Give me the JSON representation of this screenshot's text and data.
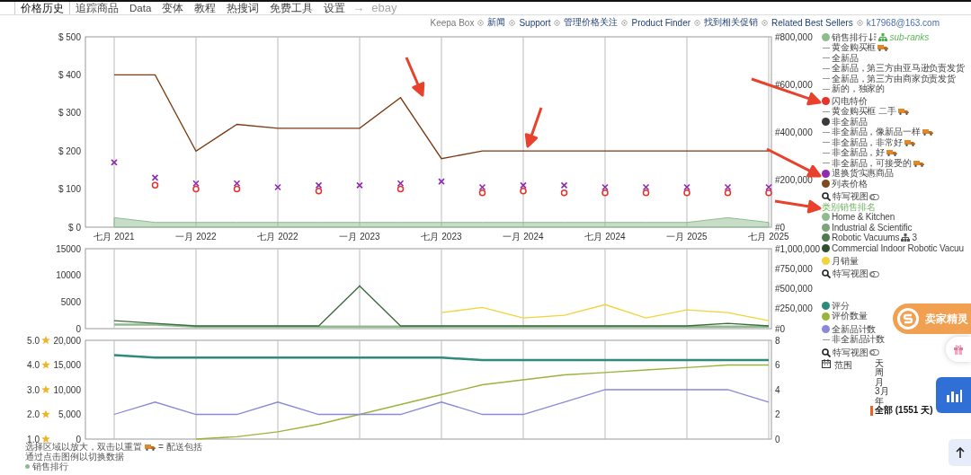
{
  "tabs": [
    {
      "label": "价格历史",
      "selected": true,
      "disabled": false
    },
    {
      "label": "追踪商品",
      "selected": false,
      "disabled": false
    },
    {
      "label": "Data",
      "selected": false,
      "disabled": false
    },
    {
      "label": "变体",
      "selected": false,
      "disabled": false
    },
    {
      "label": "教程",
      "selected": false,
      "disabled": false
    },
    {
      "label": "热搜词",
      "selected": false,
      "disabled": false
    },
    {
      "label": "免费工具",
      "selected": false,
      "disabled": false
    },
    {
      "label": "设置",
      "selected": false,
      "disabled": false
    },
    {
      "label": "ebay",
      "selected": false,
      "disabled": true
    }
  ],
  "tab_arrow": "→",
  "links": [
    {
      "label": "Keepa Box",
      "kind": "text"
    },
    {
      "label": "新闻",
      "kind": "link"
    },
    {
      "label": "Support",
      "kind": "link"
    },
    {
      "label": "管理价格关注",
      "kind": "link"
    },
    {
      "label": "Product Finder",
      "kind": "link"
    },
    {
      "label": "找到相关促销",
      "kind": "link"
    },
    {
      "label": "Related Best Sellers",
      "kind": "link"
    },
    {
      "label": "k17968@163.com",
      "kind": "account"
    }
  ],
  "charts": [
    {
      "chart_data": {
        "type": "line",
        "grid": true,
        "categories": [
          "七月 2021",
          null,
          "一月 2022",
          null,
          "七月 2022",
          null,
          "一月 2023",
          null,
          "七月 2023",
          null,
          "一月 2024",
          null,
          "七月 2024",
          null,
          "一月 2025",
          null,
          "七月 2025"
        ],
        "ylim": [
          0,
          500
        ],
        "yticks": [
          {
            "value": 0,
            "label": "$ 0"
          },
          {
            "value": 100,
            "label": "$ 100"
          },
          {
            "value": 200,
            "label": "$ 200"
          },
          {
            "value": 300,
            "label": "$ 300"
          },
          {
            "value": 400,
            "label": "$ 400"
          },
          {
            "value": 500,
            "label": "$ 500"
          }
        ],
        "y2lim": [
          0,
          800000
        ],
        "y2ticks": [
          {
            "value": 0,
            "label": "#0"
          },
          {
            "value": 200000,
            "label": "#200,000"
          },
          {
            "value": 400000,
            "label": "#400,000"
          },
          {
            "value": 600000,
            "label": "#600,000"
          },
          {
            "value": 800000,
            "label": "#800,000"
          }
        ],
        "series": [
          {
            "type": "area",
            "color": "#8fbc8f",
            "axis": "y2",
            "values": [
              40000,
              20000,
              20000,
              20000,
              20000,
              20000,
              20000,
              20000,
              20000,
              20000,
              20000,
              20000,
              20000,
              20000,
              20000,
              40000,
              20000
            ]
          },
          {
            "type": "line",
            "color": "#7b3b12",
            "values": [
              400,
              400,
              200,
              270,
              260,
              260,
              260,
              340,
              180,
              200,
              200,
              200,
              200,
              200,
              200,
              200,
              200
            ]
          },
          {
            "type": "scatter",
            "color": "#e8312a",
            "values": [
              null,
              110,
              100,
              100,
              null,
              95,
              null,
              100,
              null,
              90,
              95,
              90,
              90,
              90,
              90,
              90,
              90
            ]
          },
          {
            "type": "scatter",
            "color": "#8e2bb0",
            "values": [
              170,
              130,
              115,
              115,
              105,
              110,
              110,
              115,
              120,
              105,
              110,
              110,
              105,
              105,
              105,
              105,
              105
            ]
          }
        ]
      }
    },
    {
      "chart_data": {
        "type": "line",
        "grid": true,
        "categories": [
          null,
          null,
          null,
          null,
          null,
          null,
          null,
          null,
          null,
          null,
          null,
          null,
          null,
          null,
          null,
          null,
          null
        ],
        "ylim": [
          0,
          15000
        ],
        "yticks": [
          0,
          5000,
          10000,
          15000
        ],
        "y2lim": [
          0,
          1000000
        ],
        "y2ticks": [
          {
            "value": 0,
            "label": "#0"
          },
          {
            "value": 250000,
            "label": "#250,000"
          },
          {
            "value": 500000,
            "label": "#500,000"
          },
          {
            "value": 750000,
            "label": "#750,000"
          },
          {
            "value": 1000000,
            "label": "#1,000,000"
          }
        ],
        "series": [
          {
            "type": "line",
            "color": "#8fbc8f",
            "axis": "y2",
            "values": [
              50000,
              50000,
              25000,
              25000,
              25000,
              25000,
              25000,
              25000,
              25000,
              25000,
              25000,
              25000,
              25000,
              25000,
              25000,
              25000,
              25000
            ]
          },
          {
            "type": "line",
            "color": "#3e6b3e",
            "values": [
              1500,
              1000,
              500,
              500,
              500,
              500,
              8000,
              500,
              500,
              500,
              500,
              500,
              500,
              500,
              500,
              1000,
              500
            ]
          },
          {
            "type": "line",
            "color": "#f2d33a",
            "values": [
              null,
              null,
              null,
              null,
              null,
              null,
              null,
              null,
              3000,
              4000,
              2000,
              2500,
              4500,
              2000,
              3500,
              3000,
              1500
            ]
          }
        ]
      }
    },
    {
      "chart_data": {
        "type": "line",
        "grid": true,
        "categories": [
          null,
          null,
          null,
          null,
          null,
          null,
          null,
          null,
          null,
          null,
          null,
          null,
          null,
          null,
          null,
          null,
          null
        ],
        "ylim": [
          0,
          20000
        ],
        "yticks": [
          {
            "value": 0,
            "label": "0"
          },
          {
            "value": 5000,
            "label": "5,000"
          },
          {
            "value": 10000,
            "label": "10,000"
          },
          {
            "value": 15000,
            "label": "15,000"
          },
          {
            "value": 20000,
            "label": "20,000"
          }
        ],
        "y2lim": [
          0,
          8
        ],
        "y2ticks": [
          0,
          2,
          4,
          6,
          8
        ],
        "y3lim": [
          1,
          5
        ],
        "y3ticks": [
          {
            "value": 1,
            "label": "1.0"
          },
          {
            "value": 2,
            "label": "2.0"
          },
          {
            "value": 3,
            "label": "3.0"
          },
          {
            "value": 4,
            "label": "4.0"
          },
          {
            "value": 5,
            "label": "5.0"
          }
        ],
        "series": [
          {
            "type": "line",
            "color": "#2e8b7a",
            "axis": "y3",
            "values": [
              4.4,
              4.3,
              4.3,
              4.3,
              4.3,
              4.3,
              4.3,
              4.3,
              4.3,
              4.2,
              4.2,
              4.2,
              4.2,
              4.2,
              4.2,
              4.2,
              4.2
            ]
          },
          {
            "type": "line",
            "color": "#9ab43a",
            "values": [
              null,
              null,
              0,
              500,
              1500,
              3000,
              5000,
              7000,
              9000,
              11000,
              12000,
              13000,
              13500,
              14000,
              14500,
              15000,
              15000
            ]
          },
          {
            "type": "line",
            "color": "#8a88d8",
            "axis": "y2",
            "values": [
              2,
              3,
              2,
              2,
              3,
              2,
              2,
              2,
              3,
              2,
              2,
              3,
              4,
              4,
              4,
              4,
              3
            ]
          }
        ]
      }
    }
  ],
  "legend": [
    {
      "kind": "dot",
      "label": "销售排行",
      "color": "#8fbc8f",
      "truck": false,
      "sub_ranks": "sub-ranks"
    },
    {
      "kind": "line",
      "label": "黄金购买框",
      "truck": true
    },
    {
      "kind": "line",
      "label": "全新品",
      "truck": false
    },
    {
      "kind": "line",
      "label": "全新品，第三方由亚马逊负责发货",
      "truck": false
    },
    {
      "kind": "line",
      "label": "全新品，第三方由商家负责发货",
      "truck": false
    },
    {
      "kind": "line",
      "label": "新的，独家的",
      "truck": false
    },
    {
      "kind": "dot",
      "label": "闪电特价",
      "color": "#e8312a",
      "truck": false
    },
    {
      "kind": "line",
      "label": "黄金购买框 二手",
      "truck": true
    },
    {
      "kind": "dot",
      "label": "非全新品",
      "color": "#3a3a3a",
      "truck": false
    },
    {
      "kind": "line",
      "label": "非全新品，像新品一样",
      "truck": true
    },
    {
      "kind": "line",
      "label": "非全新品，非常好",
      "truck": true
    },
    {
      "kind": "line",
      "label": "非全新品，好",
      "truck": true
    },
    {
      "kind": "line",
      "label": "非全新品，可接受的",
      "truck": true
    },
    {
      "kind": "dot",
      "label": "退换货实惠商品",
      "color": "#8e2bb0",
      "truck": false
    },
    {
      "kind": "dot",
      "label": "列表价格",
      "color": "#7b4a1e",
      "truck": false
    }
  ],
  "closeup_1": {
    "label": "特写视图"
  },
  "category_title": "类别销售排名",
  "legend_2": [
    {
      "kind": "dot",
      "label": "Home & Kitchen",
      "color": "#8fbc8f"
    },
    {
      "kind": "dot",
      "label": "Industrial & Scientific",
      "color": "#7aa47a"
    },
    {
      "kind": "dot",
      "label": "Robotic Vacuums",
      "color": "#4f7a4f",
      "sub_count": "3"
    },
    {
      "kind": "dot",
      "label": "Commercial Indoor Robotic Vacuu",
      "color": "#2f4f2f"
    },
    {
      "kind": "dot",
      "label": "月销量",
      "color": "#f2d33a"
    }
  ],
  "closeup_2": {
    "label": "特写视图"
  },
  "legend_3": [
    {
      "kind": "dot",
      "label": "评分",
      "color": "#2e8b7a"
    },
    {
      "kind": "dot",
      "label": "评价数量",
      "color": "#9ab43a"
    },
    {
      "kind": "dot",
      "label": "全新品计数",
      "color": "#8a88d8"
    },
    {
      "kind": "line",
      "label": "非全新品计数"
    }
  ],
  "closeup_3": {
    "label": "特写视图"
  },
  "range": {
    "label": "范围",
    "options": [
      {
        "label": "天",
        "selected": false
      },
      {
        "label": "周",
        "selected": false
      },
      {
        "label": "月",
        "selected": false
      },
      {
        "label": "3月",
        "selected": false
      },
      {
        "label": "年",
        "selected": false
      },
      {
        "label": "全部 (1551 天)",
        "selected": true
      }
    ]
  },
  "notes": [
    "选择区域以放大，双击以重置",
    "通过点击图例以切换数据"
  ],
  "truck_note": "= 配送包括",
  "bottom_legend": {
    "label": "销售排行",
    "color": "#8fbc8f"
  },
  "side_widget": {
    "label": "卖家精灵"
  }
}
